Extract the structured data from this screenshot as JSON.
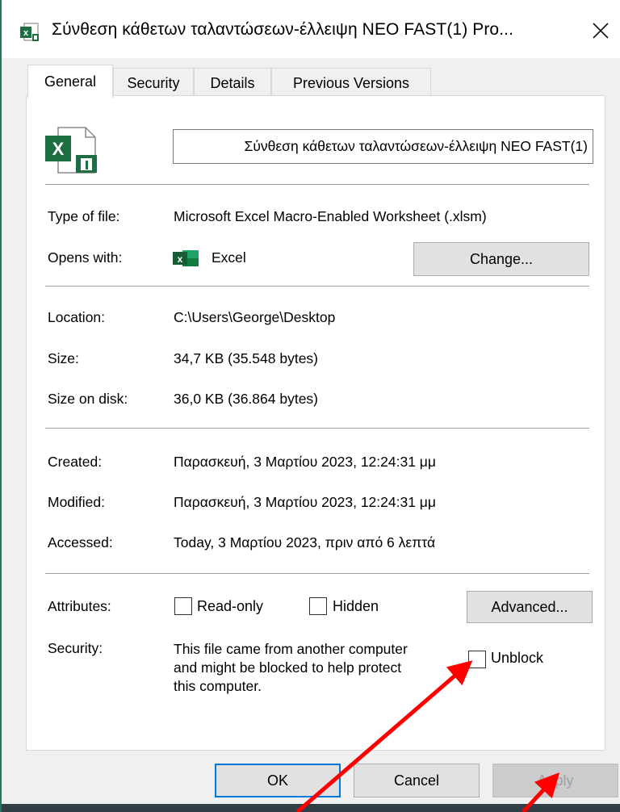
{
  "window": {
    "title": "Σύνθεση κάθετων ταλαντώσεων-έλλειψη NEO FAST(1) Pro...",
    "close_label": "✕"
  },
  "tabs": [
    {
      "label": "General",
      "active": true
    },
    {
      "label": "Security",
      "active": false
    },
    {
      "label": "Details",
      "active": false
    },
    {
      "label": "Previous Versions",
      "active": false
    }
  ],
  "file": {
    "name": "Σύνθεση κάθετων ταλαντώσεων-έλλειψη NEO FAST(1)",
    "name_visible": "Σύνθεση κάθετων ταλαντώσεων-έλλειψη NEO FAST(1)"
  },
  "info": {
    "type_label": "Type of file:",
    "type_value": "Microsoft Excel Macro-Enabled Worksheet (.xlsm)",
    "opens_label": "Opens with:",
    "opens_value": "Excel",
    "change_label": "Change...",
    "location_label": "Location:",
    "location_value": "C:\\Users\\George\\Desktop",
    "size_label": "Size:",
    "size_value": "34,7 KB (35.548 bytes)",
    "size_disk_label": "Size on disk:",
    "size_disk_value": "36,0 KB (36.864 bytes)",
    "created_label": "Created:",
    "created_value": "Παρασκευή, 3 Μαρτίου 2023, 12:24:31 μμ",
    "modified_label": "Modified:",
    "modified_value": "Παρασκευή, 3 Μαρτίου 2023, 12:24:31 μμ",
    "accessed_label": "Accessed:",
    "accessed_value": "Today, 3 Μαρτίου 2023, πριν από 6 λεπτά"
  },
  "attributes": {
    "label": "Attributes:",
    "readonly_label": "Read-only",
    "readonly_checked": false,
    "hidden_label": "Hidden",
    "hidden_checked": false,
    "advanced_label": "Advanced..."
  },
  "security": {
    "label": "Security:",
    "message_line1": "This file came from another computer",
    "message_line2": "and might be blocked to help protect",
    "message_line3": "this computer.",
    "unblock_label": "Unblock",
    "unblock_checked": false
  },
  "buttons": {
    "ok": "OK",
    "cancel": "Cancel",
    "apply": "Apply"
  },
  "colors": {
    "excel_green": "#1d6f42",
    "annotation_arrow": "#ff0000",
    "focus_blue": "#0078d7"
  },
  "icons": {
    "title": "excel-file-icon",
    "file": "excel-macro-file-icon",
    "app": "excel-app-icon",
    "close": "close-icon"
  }
}
